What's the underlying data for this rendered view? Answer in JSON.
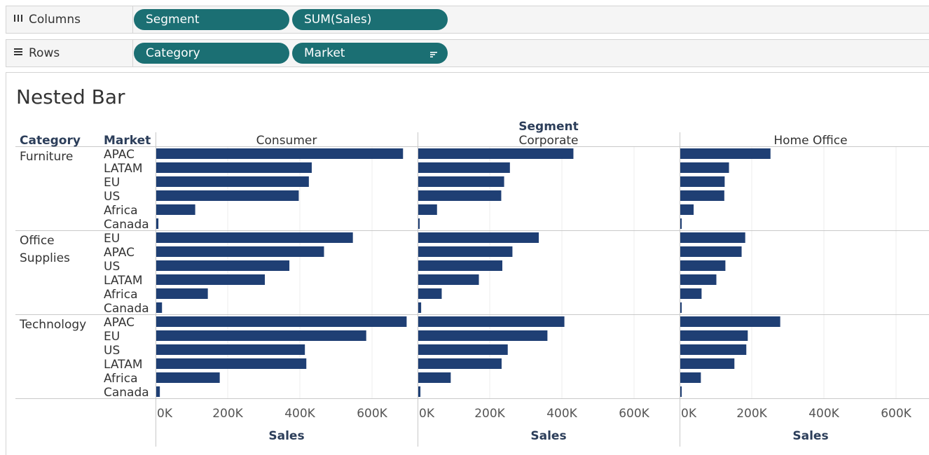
{
  "shelves": {
    "columns": {
      "label": "Columns",
      "pills": [
        "Segment",
        "SUM(Sales)"
      ]
    },
    "rows": {
      "label": "Rows",
      "pills": [
        "Category",
        "Market"
      ]
    }
  },
  "sheet_title": "Nested Bar",
  "headers": {
    "category": "Category",
    "market": "Market",
    "segment": "Segment",
    "axis_title": "Sales"
  },
  "colors": {
    "bar": "#1f3f74",
    "pill": "#1b6f73",
    "header_text": "#2c3e5a"
  },
  "chart_data": {
    "type": "bar",
    "orientation": "horizontal",
    "title": "Nested Bar",
    "xlabel": "Sales",
    "xlim": [
      0,
      700000
    ],
    "x_ticks": [
      "0K",
      "200K",
      "400K",
      "600K"
    ],
    "x_tick_values": [
      0,
      200000,
      400000,
      600000
    ],
    "segments": [
      "Consumer",
      "Corporate",
      "Home Office"
    ],
    "categories": [
      {
        "name": "Furniture",
        "label_lines": [
          "Furniture"
        ],
        "markets": [
          "APAC",
          "LATAM",
          "EU",
          "US",
          "Africa",
          "Canada"
        ],
        "values": {
          "Consumer": [
            684000,
            431000,
            423000,
            395000,
            108000,
            6000
          ],
          "Corporate": [
            430000,
            254000,
            238000,
            230000,
            52000,
            1000
          ],
          "Home Office": [
            250000,
            135000,
            123000,
            122000,
            37000,
            1000
          ]
        }
      },
      {
        "name": "Office Supplies",
        "label_lines": [
          "Office",
          "Supplies"
        ],
        "markets": [
          "EU",
          "APAC",
          "US",
          "LATAM",
          "Africa",
          "Canada"
        ],
        "values": {
          "Consumer": [
            545000,
            465000,
            369000,
            301000,
            143000,
            16000
          ],
          "Corporate": [
            334000,
            261000,
            233000,
            168000,
            65000,
            8000
          ],
          "Home Office": [
            180000,
            170000,
            125000,
            100000,
            59000,
            2000
          ]
        }
      },
      {
        "name": "Technology",
        "label_lines": [
          "Technology"
        ],
        "markets": [
          "APAC",
          "EU",
          "US",
          "LATAM",
          "Africa",
          "Canada"
        ],
        "values": {
          "Consumer": [
            694000,
            582000,
            412000,
            416000,
            176000,
            10000
          ],
          "Corporate": [
            405000,
            358000,
            248000,
            231000,
            90000,
            6000
          ],
          "Home Office": [
            277000,
            187000,
            183000,
            150000,
            57000,
            3000
          ]
        }
      }
    ]
  }
}
